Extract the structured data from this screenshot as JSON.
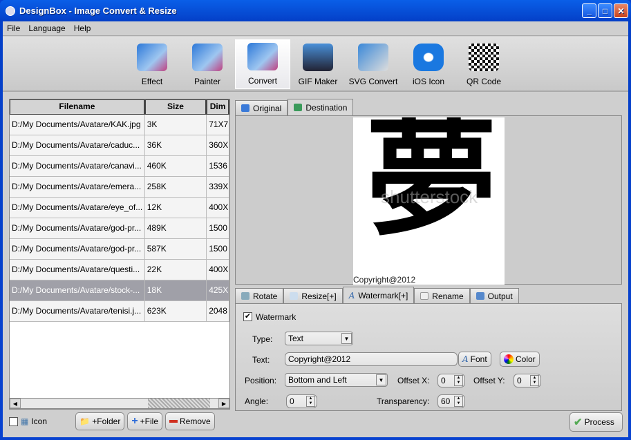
{
  "window": {
    "title": "DesignBox - Image Convert & Resize"
  },
  "menu": [
    "File",
    "Language",
    "Help"
  ],
  "toolbar": [
    {
      "label": "Effect"
    },
    {
      "label": "Painter"
    },
    {
      "label": "Convert",
      "active": true
    },
    {
      "label": "GIF Maker"
    },
    {
      "label": "SVG Convert"
    },
    {
      "label": "iOS Icon"
    },
    {
      "label": "QR Code"
    }
  ],
  "table": {
    "columns": [
      "Filename",
      "Size",
      "Dim"
    ],
    "rows": [
      [
        "D:/My Documents/Avatare/KAK.jpg",
        "3K",
        "71X7"
      ],
      [
        "D:/My Documents/Avatare/caduc...",
        "36K",
        "360X"
      ],
      [
        "D:/My Documents/Avatare/canavi...",
        "460K",
        "1536"
      ],
      [
        "D:/My Documents/Avatare/emera...",
        "258K",
        "339X"
      ],
      [
        "D:/My Documents/Avatare/eye_of...",
        "12K",
        "400X"
      ],
      [
        "D:/My Documents/Avatare/god-pr...",
        "489K",
        "1500"
      ],
      [
        "D:/My Documents/Avatare/god-pr...",
        "587K",
        "1500"
      ],
      [
        "D:/My Documents/Avatare/questi...",
        "22K",
        "400X"
      ],
      [
        "D:/My Documents/Avatare/stock-...",
        "18K",
        "425X"
      ],
      [
        "D:/My Documents/Avatare/tenisi.j...",
        "623K",
        "2048"
      ]
    ],
    "selected_index": 8
  },
  "left_bottom": {
    "icon_label": "Icon",
    "add_folder": "+Folder",
    "add_file": "+File",
    "remove": "Remove"
  },
  "preview_tabs": [
    {
      "label": "Original"
    },
    {
      "label": "Destination",
      "active": true
    }
  ],
  "preview": {
    "watermark_text": "Copyright@2012",
    "kanji": "夢",
    "stock": "shutterstock"
  },
  "option_tabs": [
    {
      "label": "Rotate"
    },
    {
      "label": "Resize[+]"
    },
    {
      "label": "Watermark[+]",
      "active": true
    },
    {
      "label": "Rename"
    },
    {
      "label": "Output"
    }
  ],
  "watermark": {
    "checkbox_label": "Watermark",
    "checked": true,
    "type_label": "Type:",
    "type_value": "Text",
    "text_label": "Text:",
    "text_value": "Copyright@2012",
    "font_btn": "Font",
    "color_btn": "Color",
    "position_label": "Position:",
    "position_value": "Bottom and Left",
    "offx_label": "Offset X:",
    "offx_value": "0",
    "offy_label": "Offset Y:",
    "offy_value": "0",
    "angle_label": "Angle:",
    "angle_value": "0",
    "transp_label": "Transparency:",
    "transp_value": "60"
  },
  "process_btn": "Process"
}
